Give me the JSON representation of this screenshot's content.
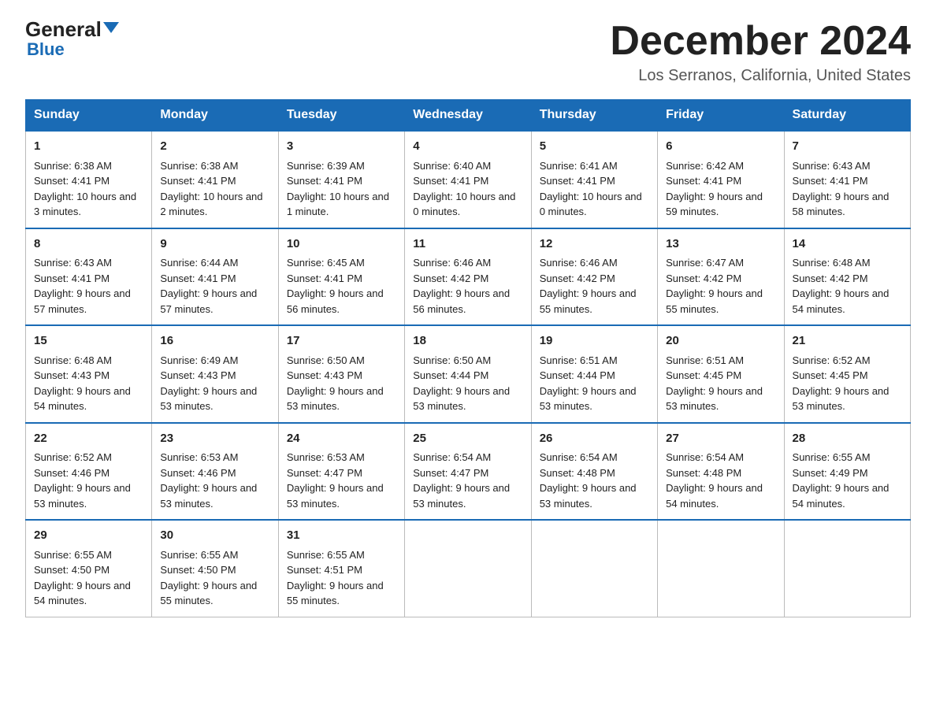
{
  "header": {
    "logo_general": "General",
    "logo_blue": "Blue",
    "month_title": "December 2024",
    "location": "Los Serranos, California, United States"
  },
  "days_of_week": [
    "Sunday",
    "Monday",
    "Tuesday",
    "Wednesday",
    "Thursday",
    "Friday",
    "Saturday"
  ],
  "weeks": [
    [
      {
        "day": "1",
        "sunrise": "6:38 AM",
        "sunset": "4:41 PM",
        "daylight": "10 hours and 3 minutes."
      },
      {
        "day": "2",
        "sunrise": "6:38 AM",
        "sunset": "4:41 PM",
        "daylight": "10 hours and 2 minutes."
      },
      {
        "day": "3",
        "sunrise": "6:39 AM",
        "sunset": "4:41 PM",
        "daylight": "10 hours and 1 minute."
      },
      {
        "day": "4",
        "sunrise": "6:40 AM",
        "sunset": "4:41 PM",
        "daylight": "10 hours and 0 minutes."
      },
      {
        "day": "5",
        "sunrise": "6:41 AM",
        "sunset": "4:41 PM",
        "daylight": "10 hours and 0 minutes."
      },
      {
        "day": "6",
        "sunrise": "6:42 AM",
        "sunset": "4:41 PM",
        "daylight": "9 hours and 59 minutes."
      },
      {
        "day": "7",
        "sunrise": "6:43 AM",
        "sunset": "4:41 PM",
        "daylight": "9 hours and 58 minutes."
      }
    ],
    [
      {
        "day": "8",
        "sunrise": "6:43 AM",
        "sunset": "4:41 PM",
        "daylight": "9 hours and 57 minutes."
      },
      {
        "day": "9",
        "sunrise": "6:44 AM",
        "sunset": "4:41 PM",
        "daylight": "9 hours and 57 minutes."
      },
      {
        "day": "10",
        "sunrise": "6:45 AM",
        "sunset": "4:41 PM",
        "daylight": "9 hours and 56 minutes."
      },
      {
        "day": "11",
        "sunrise": "6:46 AM",
        "sunset": "4:42 PM",
        "daylight": "9 hours and 56 minutes."
      },
      {
        "day": "12",
        "sunrise": "6:46 AM",
        "sunset": "4:42 PM",
        "daylight": "9 hours and 55 minutes."
      },
      {
        "day": "13",
        "sunrise": "6:47 AM",
        "sunset": "4:42 PM",
        "daylight": "9 hours and 55 minutes."
      },
      {
        "day": "14",
        "sunrise": "6:48 AM",
        "sunset": "4:42 PM",
        "daylight": "9 hours and 54 minutes."
      }
    ],
    [
      {
        "day": "15",
        "sunrise": "6:48 AM",
        "sunset": "4:43 PM",
        "daylight": "9 hours and 54 minutes."
      },
      {
        "day": "16",
        "sunrise": "6:49 AM",
        "sunset": "4:43 PM",
        "daylight": "9 hours and 53 minutes."
      },
      {
        "day": "17",
        "sunrise": "6:50 AM",
        "sunset": "4:43 PM",
        "daylight": "9 hours and 53 minutes."
      },
      {
        "day": "18",
        "sunrise": "6:50 AM",
        "sunset": "4:44 PM",
        "daylight": "9 hours and 53 minutes."
      },
      {
        "day": "19",
        "sunrise": "6:51 AM",
        "sunset": "4:44 PM",
        "daylight": "9 hours and 53 minutes."
      },
      {
        "day": "20",
        "sunrise": "6:51 AM",
        "sunset": "4:45 PM",
        "daylight": "9 hours and 53 minutes."
      },
      {
        "day": "21",
        "sunrise": "6:52 AM",
        "sunset": "4:45 PM",
        "daylight": "9 hours and 53 minutes."
      }
    ],
    [
      {
        "day": "22",
        "sunrise": "6:52 AM",
        "sunset": "4:46 PM",
        "daylight": "9 hours and 53 minutes."
      },
      {
        "day": "23",
        "sunrise": "6:53 AM",
        "sunset": "4:46 PM",
        "daylight": "9 hours and 53 minutes."
      },
      {
        "day": "24",
        "sunrise": "6:53 AM",
        "sunset": "4:47 PM",
        "daylight": "9 hours and 53 minutes."
      },
      {
        "day": "25",
        "sunrise": "6:54 AM",
        "sunset": "4:47 PM",
        "daylight": "9 hours and 53 minutes."
      },
      {
        "day": "26",
        "sunrise": "6:54 AM",
        "sunset": "4:48 PM",
        "daylight": "9 hours and 53 minutes."
      },
      {
        "day": "27",
        "sunrise": "6:54 AM",
        "sunset": "4:48 PM",
        "daylight": "9 hours and 54 minutes."
      },
      {
        "day": "28",
        "sunrise": "6:55 AM",
        "sunset": "4:49 PM",
        "daylight": "9 hours and 54 minutes."
      }
    ],
    [
      {
        "day": "29",
        "sunrise": "6:55 AM",
        "sunset": "4:50 PM",
        "daylight": "9 hours and 54 minutes."
      },
      {
        "day": "30",
        "sunrise": "6:55 AM",
        "sunset": "4:50 PM",
        "daylight": "9 hours and 55 minutes."
      },
      {
        "day": "31",
        "sunrise": "6:55 AM",
        "sunset": "4:51 PM",
        "daylight": "9 hours and 55 minutes."
      },
      null,
      null,
      null,
      null
    ]
  ],
  "labels": {
    "sunrise": "Sunrise:",
    "sunset": "Sunset:",
    "daylight": "Daylight:"
  }
}
